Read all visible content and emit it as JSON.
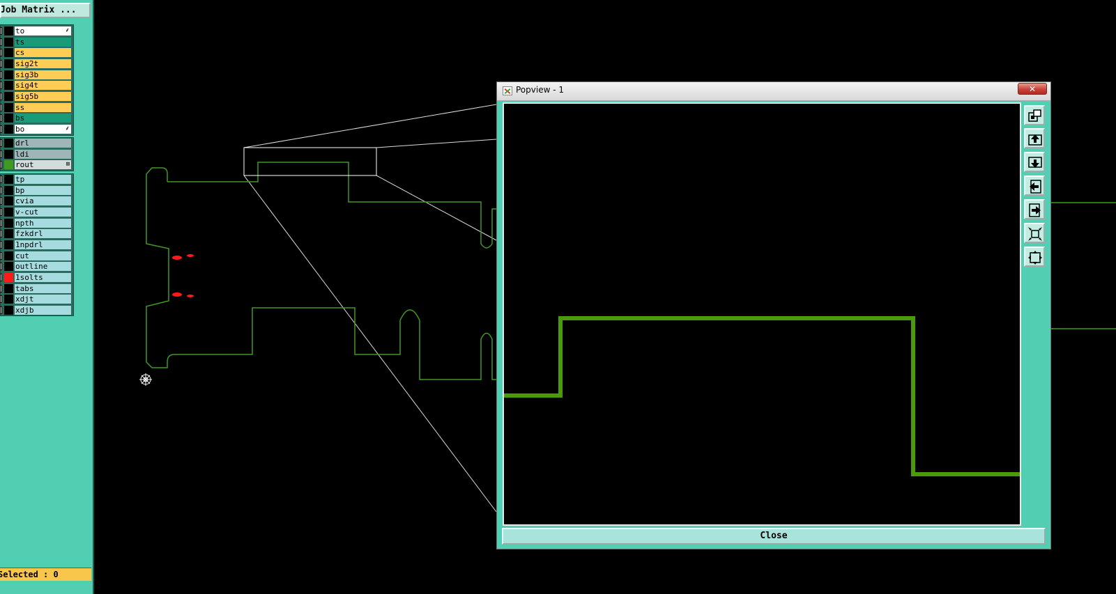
{
  "job_matrix_label": "Job Matrix ...",
  "layers_group1": [
    {
      "name": "to",
      "color": "#ffffff",
      "mark": "⸙"
    },
    {
      "name": "ts",
      "color": "#199a79",
      "mark": ""
    },
    {
      "name": "cs",
      "color": "#ffcc55",
      "mark": ""
    },
    {
      "name": "sig2t",
      "color": "#ffcc55",
      "mark": ""
    },
    {
      "name": "sig3b",
      "color": "#ffcc55",
      "mark": ""
    },
    {
      "name": "sig4t",
      "color": "#ffcc55",
      "mark": ""
    },
    {
      "name": "sig5b",
      "color": "#ffcc55",
      "mark": ""
    },
    {
      "name": "ss",
      "color": "#ffcc55",
      "mark": ""
    },
    {
      "name": "bs",
      "color": "#199a79",
      "mark": ""
    },
    {
      "name": "bo",
      "color": "#ffffff",
      "mark": "⸙"
    }
  ],
  "layers_group2": [
    {
      "name": "drl",
      "color": "#9fb5b8",
      "swatch": ""
    },
    {
      "name": "ldi",
      "color": "#9fb5b8",
      "swatch": ""
    },
    {
      "name": "rout",
      "color": "#d2dcda",
      "swatch": "#3f9a22",
      "mark": "⊞"
    }
  ],
  "layers_group3": [
    {
      "name": "tp",
      "swatch": ""
    },
    {
      "name": "bp",
      "swatch": ""
    },
    {
      "name": "cvia",
      "swatch": ""
    },
    {
      "name": "v-cut",
      "swatch": ""
    },
    {
      "name": "npth",
      "swatch": ""
    },
    {
      "name": "fzkdrl",
      "swatch": ""
    },
    {
      "name": "1npdrl",
      "swatch": ""
    },
    {
      "name": "cut",
      "swatch": ""
    },
    {
      "name": "outline",
      "swatch": ""
    },
    {
      "name": "1solts",
      "swatch": "#ff1a1a"
    },
    {
      "name": "tabs",
      "swatch": ""
    },
    {
      "name": "xdjt",
      "swatch": ""
    },
    {
      "name": "xdjb",
      "swatch": ""
    }
  ],
  "selected_status": "Selected : 0",
  "popview": {
    "title": "Popview - 1",
    "close_x": "✕",
    "close_label": "Close",
    "tools": [
      "zoom-home-icon",
      "pan-up-icon",
      "pan-down-icon",
      "pan-left-icon",
      "pan-right-icon",
      "zoom-out-icon",
      "zoom-in-icon"
    ]
  },
  "colors": {
    "panel": "#52cfb3",
    "route_line": "#3f9a22",
    "popview_line": "#4a9a0a",
    "zoom_box": "#ffffff",
    "marker": "#ff1a1a"
  }
}
